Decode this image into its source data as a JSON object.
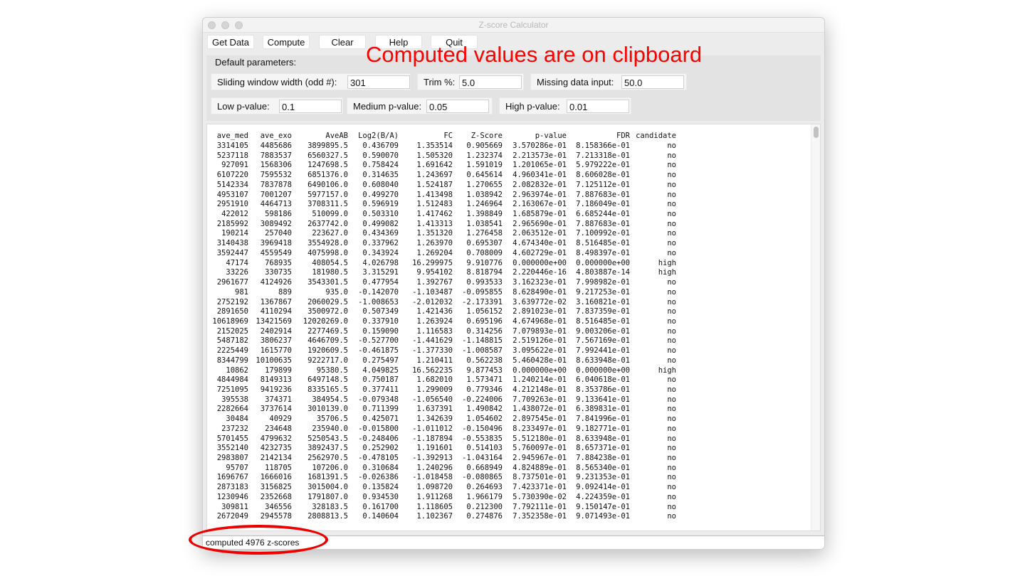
{
  "window": {
    "title": "Z-score Calculator"
  },
  "toolbar": {
    "buttons": [
      "Get Data",
      "Compute",
      "Clear",
      "Help",
      "Quit"
    ]
  },
  "params": {
    "section_label": "Default parameters:",
    "sliding_window": {
      "label": "Sliding window width (odd #):",
      "value": "301"
    },
    "trim": {
      "label": "Trim %:",
      "value": "5.0"
    },
    "missing": {
      "label": "Missing data input:",
      "value": "50.0"
    },
    "low_p": {
      "label": "Low p-value:",
      "value": "0.1"
    },
    "medium_p": {
      "label": "Medium p-value:",
      "value": "0.05"
    },
    "high_p": {
      "label": "High p-value:",
      "value": "0.01"
    }
  },
  "table": {
    "columns": [
      "ave_med",
      "ave_exo",
      "AveAB",
      "Log2(B/A)",
      "FC",
      "Z-Score",
      "p-value",
      "FDR",
      "candidate"
    ],
    "rows": [
      [
        "3314105",
        "4485686",
        "3899895.5",
        "0.436709",
        "1.353514",
        "0.905669",
        "3.570286e-01",
        "8.158366e-01",
        "no"
      ],
      [
        "5237118",
        "7883537",
        "6560327.5",
        "0.590070",
        "1.505320",
        "1.232374",
        "2.213573e-01",
        "7.213318e-01",
        "no"
      ],
      [
        "927091",
        "1568306",
        "1247698.5",
        "0.758424",
        "1.691642",
        "1.591019",
        "1.201065e-01",
        "5.979222e-01",
        "no"
      ],
      [
        "6107220",
        "7595532",
        "6851376.0",
        "0.314635",
        "1.243697",
        "0.645614",
        "4.960341e-01",
        "8.606028e-01",
        "no"
      ],
      [
        "5142334",
        "7837878",
        "6490106.0",
        "0.608040",
        "1.524187",
        "1.270655",
        "2.082832e-01",
        "7.125112e-01",
        "no"
      ],
      [
        "4953107",
        "7001207",
        "5977157.0",
        "0.499270",
        "1.413498",
        "1.038942",
        "2.963974e-01",
        "7.887683e-01",
        "no"
      ],
      [
        "2951910",
        "4464713",
        "3708311.5",
        "0.596919",
        "1.512483",
        "1.246964",
        "2.163067e-01",
        "7.186049e-01",
        "no"
      ],
      [
        "422012",
        "598186",
        "510099.0",
        "0.503310",
        "1.417462",
        "1.398849",
        "1.685879e-01",
        "6.685244e-01",
        "no"
      ],
      [
        "2185992",
        "3089492",
        "2637742.0",
        "0.499082",
        "1.413313",
        "1.038541",
        "2.965690e-01",
        "7.887683e-01",
        "no"
      ],
      [
        "190214",
        "257040",
        "223627.0",
        "0.434369",
        "1.351320",
        "1.276458",
        "2.063512e-01",
        "7.100992e-01",
        "no"
      ],
      [
        "3140438",
        "3969418",
        "3554928.0",
        "0.337962",
        "1.263970",
        "0.695307",
        "4.674340e-01",
        "8.516485e-01",
        "no"
      ],
      [
        "3592447",
        "4559549",
        "4075998.0",
        "0.343924",
        "1.269204",
        "0.708009",
        "4.602729e-01",
        "8.498397e-01",
        "no"
      ],
      [
        "47174",
        "768935",
        "408054.5",
        "4.026798",
        "16.299975",
        "9.910776",
        "0.000000e+00",
        "0.000000e+00",
        "high"
      ],
      [
        "33226",
        "330735",
        "181980.5",
        "3.315291",
        "9.954102",
        "8.818794",
        "2.220446e-16",
        "4.803887e-14",
        "high"
      ],
      [
        "2961677",
        "4124926",
        "3543301.5",
        "0.477954",
        "1.392767",
        "0.993533",
        "3.162323e-01",
        "7.998982e-01",
        "no"
      ],
      [
        "981",
        "889",
        "935.0",
        "-0.142070",
        "-1.103487",
        "-0.095855",
        "8.628490e-01",
        "9.217253e-01",
        "no"
      ],
      [
        "2752192",
        "1367867",
        "2060029.5",
        "-1.008653",
        "-2.012032",
        "-2.173391",
        "3.639772e-02",
        "3.160821e-01",
        "no"
      ],
      [
        "2891650",
        "4110294",
        "3500972.0",
        "0.507349",
        "1.421436",
        "1.056152",
        "2.891023e-01",
        "7.837359e-01",
        "no"
      ],
      [
        "10618969",
        "13421569",
        "12020269.0",
        "0.337910",
        "1.263924",
        "0.695196",
        "4.674968e-01",
        "8.516485e-01",
        "no"
      ],
      [
        "2152025",
        "2402914",
        "2277469.5",
        "0.159090",
        "1.116583",
        "0.314256",
        "7.079893e-01",
        "9.003206e-01",
        "no"
      ],
      [
        "5487182",
        "3806237",
        "4646709.5",
        "-0.527700",
        "-1.441629",
        "-1.148815",
        "2.519126e-01",
        "7.567169e-01",
        "no"
      ],
      [
        "2225449",
        "1615770",
        "1920609.5",
        "-0.461875",
        "-1.377330",
        "-1.008587",
        "3.095622e-01",
        "7.992441e-01",
        "no"
      ],
      [
        "8344799",
        "10100635",
        "9222717.0",
        "0.275497",
        "1.210411",
        "0.562238",
        "5.460428e-01",
        "8.633948e-01",
        "no"
      ],
      [
        "10862",
        "179899",
        "95380.5",
        "4.049825",
        "16.562235",
        "9.877453",
        "0.000000e+00",
        "0.000000e+00",
        "high"
      ],
      [
        "4844984",
        "8149313",
        "6497148.5",
        "0.750187",
        "1.682010",
        "1.573471",
        "1.240214e-01",
        "6.040618e-01",
        "no"
      ],
      [
        "7251095",
        "9419236",
        "8335165.5",
        "0.377411",
        "1.299009",
        "0.779346",
        "4.212148e-01",
        "8.353786e-01",
        "no"
      ],
      [
        "395538",
        "374371",
        "384954.5",
        "-0.079348",
        "-1.056540",
        "-0.224006",
        "7.709263e-01",
        "9.133641e-01",
        "no"
      ],
      [
        "2282664",
        "3737614",
        "3010139.0",
        "0.711399",
        "1.637391",
        "1.490842",
        "1.438072e-01",
        "6.389831e-01",
        "no"
      ],
      [
        "30484",
        "40929",
        "35706.5",
        "0.425071",
        "1.342639",
        "1.054602",
        "2.897545e-01",
        "7.841996e-01",
        "no"
      ],
      [
        "237232",
        "234648",
        "235940.0",
        "-0.015800",
        "-1.011012",
        "-0.150496",
        "8.233497e-01",
        "9.182771e-01",
        "no"
      ],
      [
        "5701455",
        "4799632",
        "5250543.5",
        "-0.248406",
        "-1.187894",
        "-0.553835",
        "5.512180e-01",
        "8.633948e-01",
        "no"
      ],
      [
        "3552140",
        "4232735",
        "3892437.5",
        "0.252902",
        "1.191601",
        "0.514103",
        "5.760097e-01",
        "8.657371e-01",
        "no"
      ],
      [
        "2983807",
        "2142134",
        "2562970.5",
        "-0.478105",
        "-1.392913",
        "-1.043164",
        "2.945967e-01",
        "7.884238e-01",
        "no"
      ],
      [
        "95707",
        "118705",
        "107206.0",
        "0.310684",
        "1.240296",
        "0.668949",
        "4.824889e-01",
        "8.565340e-01",
        "no"
      ],
      [
        "1696767",
        "1666016",
        "1681391.5",
        "-0.026386",
        "-1.018458",
        "-0.080865",
        "8.737501e-01",
        "9.231353e-01",
        "no"
      ],
      [
        "2873183",
        "3156825",
        "3015004.0",
        "0.135824",
        "1.098720",
        "0.264693",
        "7.423371e-01",
        "9.092414e-01",
        "no"
      ],
      [
        "1230946",
        "2352668",
        "1791807.0",
        "0.934530",
        "1.911268",
        "1.966179",
        "5.730390e-02",
        "4.224359e-01",
        "no"
      ],
      [
        "309811",
        "346556",
        "328183.5",
        "0.161700",
        "1.118605",
        "0.212300",
        "7.792111e-01",
        "9.150147e-01",
        "no"
      ],
      [
        "2672049",
        "2945578",
        "2808813.5",
        "0.140604",
        "1.102367",
        "0.274876",
        "7.352358e-01",
        "9.071493e-01",
        "no"
      ]
    ]
  },
  "status": {
    "text": "computed 4976 z-scores"
  },
  "annotation": {
    "text": "Computed values are on clipboard",
    "color": "#ff0000"
  }
}
